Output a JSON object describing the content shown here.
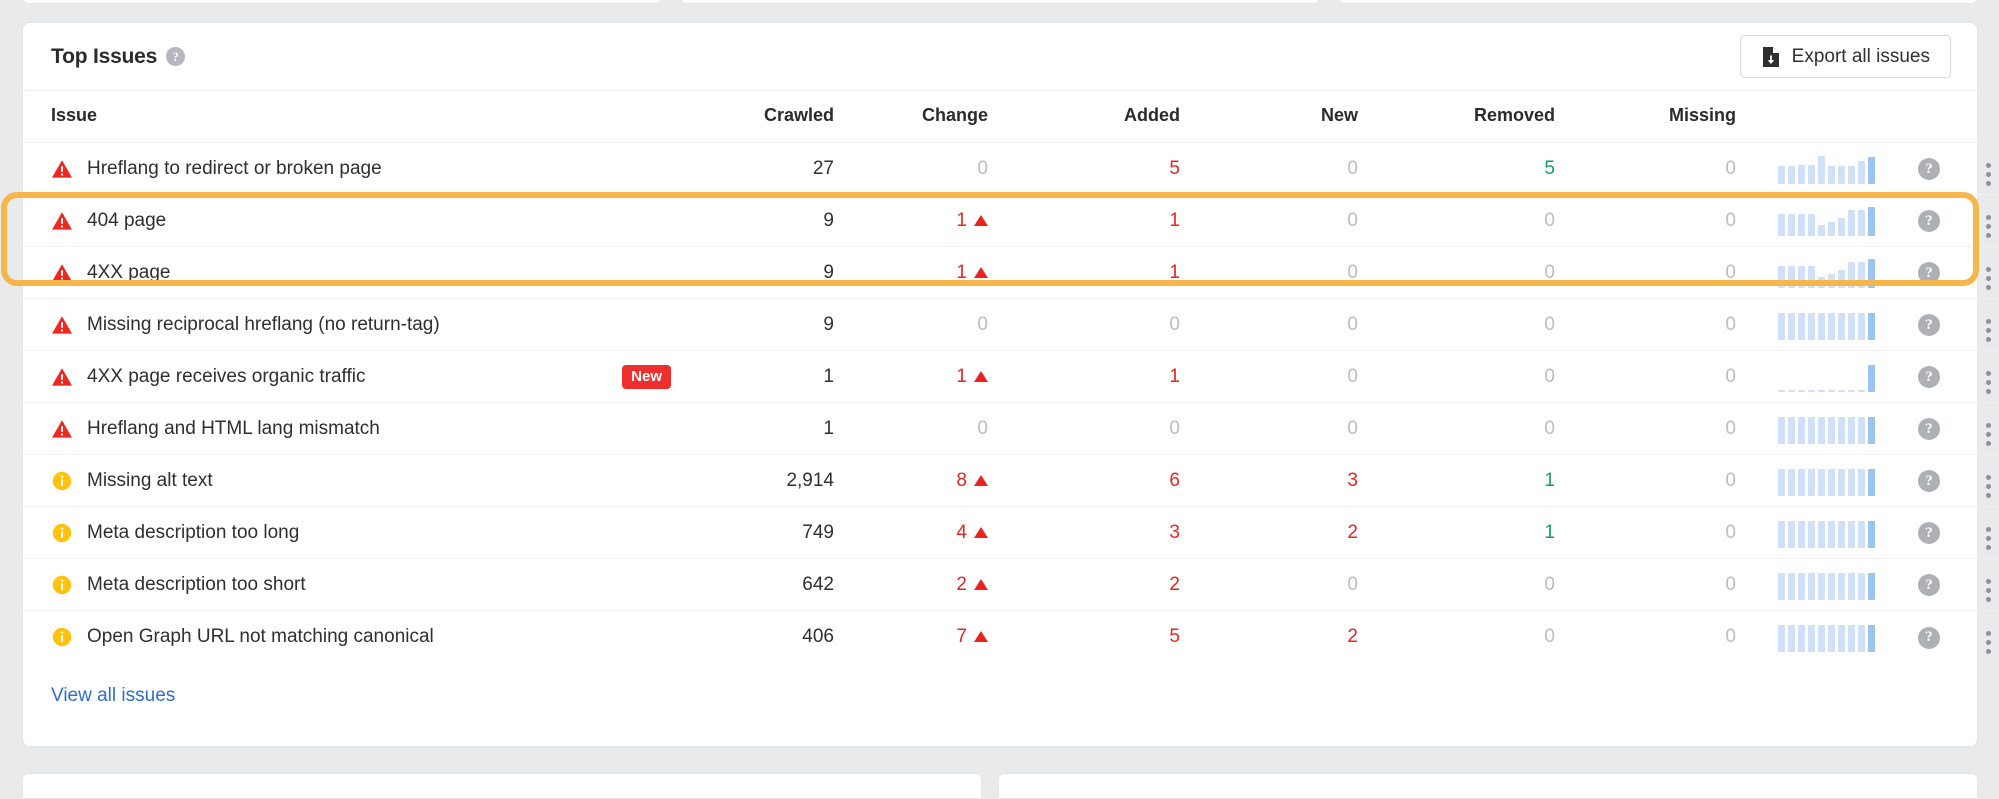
{
  "panel": {
    "title": "Top Issues",
    "title_help_icon": "help-circle-icon",
    "export_label": "Export all issues",
    "export_icon": "file-download-icon",
    "view_all_label": "View all issues"
  },
  "table": {
    "columns": [
      "Issue",
      "Crawled",
      "Change",
      "Added",
      "New",
      "Removed",
      "Missing"
    ],
    "rows": [
      {
        "severity": "error",
        "label": "Hreflang to redirect or broken page",
        "badge": "",
        "crawled": "27",
        "change": "0",
        "change_dir": "none",
        "added": "5",
        "new": "0",
        "removed": "5",
        "missing": "0",
        "sparkline": [
          60,
          60,
          62,
          62,
          92,
          60,
          58,
          60,
          74,
          88
        ],
        "help_icon": "help-circle-icon",
        "menu_icon": "kebab-menu-icon"
      },
      {
        "severity": "error",
        "label": "404 page",
        "badge": "",
        "crawled": "9",
        "change": "1",
        "change_dir": "up",
        "added": "1",
        "new": "0",
        "removed": "0",
        "missing": "0",
        "sparkline": [
          72,
          72,
          72,
          72,
          34,
          44,
          58,
          84,
          84,
          96
        ],
        "help_icon": "help-circle-icon",
        "menu_icon": "kebab-menu-icon"
      },
      {
        "severity": "error",
        "label": "4XX page",
        "badge": "",
        "crawled": "9",
        "change": "1",
        "change_dir": "up",
        "added": "1",
        "new": "0",
        "removed": "0",
        "missing": "0",
        "sparkline": [
          72,
          72,
          72,
          72,
          34,
          44,
          58,
          84,
          84,
          96
        ],
        "help_icon": "help-circle-icon",
        "menu_icon": "kebab-menu-icon"
      },
      {
        "severity": "error",
        "label": "Missing reciprocal hreflang (no return-tag)",
        "badge": "",
        "crawled": "9",
        "change": "0",
        "change_dir": "none",
        "added": "0",
        "new": "0",
        "removed": "0",
        "missing": "0",
        "sparkline": [
          88,
          88,
          88,
          88,
          88,
          88,
          88,
          88,
          88,
          88
        ],
        "help_icon": "help-circle-icon",
        "menu_icon": "kebab-menu-icon"
      },
      {
        "severity": "error",
        "label": "4XX page receives organic traffic",
        "badge": "New",
        "crawled": "1",
        "change": "1",
        "change_dir": "up",
        "added": "1",
        "new": "0",
        "removed": "0",
        "missing": "0",
        "sparkline": [
          4,
          4,
          4,
          4,
          4,
          4,
          4,
          4,
          4,
          90
        ],
        "help_icon": "help-circle-icon",
        "menu_icon": "kebab-menu-icon"
      },
      {
        "severity": "error",
        "label": "Hreflang and HTML lang mismatch",
        "badge": "",
        "crawled": "1",
        "change": "0",
        "change_dir": "none",
        "added": "0",
        "new": "0",
        "removed": "0",
        "missing": "0",
        "sparkline": [
          88,
          88,
          88,
          88,
          88,
          88,
          88,
          88,
          88,
          88
        ],
        "help_icon": "help-circle-icon",
        "menu_icon": "kebab-menu-icon"
      },
      {
        "severity": "warning",
        "label": "Missing alt text",
        "badge": "",
        "crawled": "2,914",
        "change": "8",
        "change_dir": "up",
        "added": "6",
        "new": "3",
        "removed": "1",
        "missing": "0",
        "sparkline": [
          88,
          88,
          88,
          88,
          88,
          88,
          88,
          88,
          88,
          90
        ],
        "help_icon": "help-circle-icon",
        "menu_icon": "kebab-menu-icon"
      },
      {
        "severity": "warning",
        "label": "Meta description too long",
        "badge": "",
        "crawled": "749",
        "change": "4",
        "change_dir": "up",
        "added": "3",
        "new": "2",
        "removed": "1",
        "missing": "0",
        "sparkline": [
          88,
          88,
          88,
          88,
          88,
          88,
          88,
          88,
          88,
          90
        ],
        "help_icon": "help-circle-icon",
        "menu_icon": "kebab-menu-icon"
      },
      {
        "severity": "warning",
        "label": "Meta description too short",
        "badge": "",
        "crawled": "642",
        "change": "2",
        "change_dir": "up",
        "added": "2",
        "new": "0",
        "removed": "0",
        "missing": "0",
        "sparkline": [
          88,
          88,
          88,
          88,
          88,
          88,
          88,
          88,
          88,
          90
        ],
        "help_icon": "help-circle-icon",
        "menu_icon": "kebab-menu-icon"
      },
      {
        "severity": "warning",
        "label": "Open Graph URL not matching canonical",
        "badge": "",
        "crawled": "406",
        "change": "7",
        "change_dir": "up",
        "added": "5",
        "new": "2",
        "removed": "0",
        "missing": "0",
        "sparkline": [
          88,
          88,
          88,
          88,
          88,
          88,
          88,
          88,
          88,
          90
        ],
        "help_icon": "help-circle-icon",
        "menu_icon": "kebab-menu-icon"
      }
    ]
  },
  "highlight": {
    "rows": [
      1,
      2
    ],
    "color": "#f7b64b"
  },
  "colors": {
    "error": "#ee2722",
    "warning": "#ffc20e",
    "positive_change": "#e8241f",
    "removed_green": "#13a05a",
    "zero_gray": "#b9bcc0",
    "link_blue": "#2f6bd4",
    "badge_red": "#ef2e2e",
    "spark_bar": "#cfe0f7",
    "spark_last": "#9cc4f0"
  }
}
